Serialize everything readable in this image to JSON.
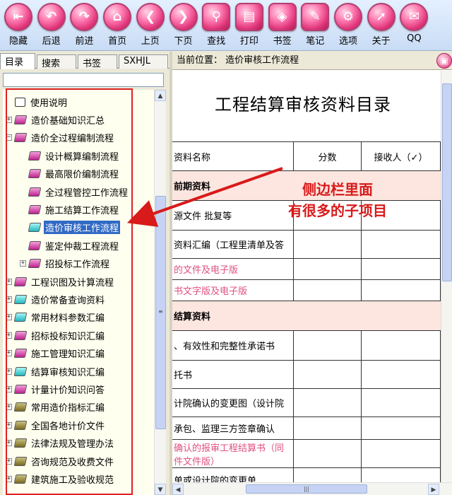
{
  "toolbar": {
    "buttons": [
      {
        "label": "隐藏",
        "icon": "hide-icon",
        "glyph": "⇤"
      },
      {
        "label": "后退",
        "icon": "back-icon",
        "glyph": "↶"
      },
      {
        "label": "前进",
        "icon": "forward-icon",
        "glyph": "↷"
      },
      {
        "label": "首页",
        "icon": "home-icon",
        "glyph": "⌂"
      },
      {
        "label": "上页",
        "icon": "prev-page-icon",
        "glyph": "❮"
      },
      {
        "label": "下页",
        "icon": "next-page-icon",
        "glyph": "❯"
      },
      {
        "label": "查找",
        "icon": "binoculars-icon",
        "glyph": "⚲"
      },
      {
        "label": "打印",
        "icon": "printer-icon",
        "glyph": "▤"
      },
      {
        "label": "书签",
        "icon": "bookmark-tag-icon",
        "glyph": "◈"
      },
      {
        "label": "笔记",
        "icon": "note-icon",
        "glyph": "✎"
      },
      {
        "label": "选项",
        "icon": "gear-icon",
        "glyph": "⚙"
      },
      {
        "label": "关于",
        "icon": "pointer-icon",
        "glyph": "➚"
      },
      {
        "label": "QQ",
        "icon": "qq-icon",
        "glyph": "✉"
      }
    ]
  },
  "left_panel": {
    "tabs": [
      "目录",
      "搜索",
      "书签",
      "SXHJL"
    ],
    "active_tab": "目录",
    "search_value": "",
    "tree": [
      {
        "label": "使用说明",
        "level": 0,
        "expander": "",
        "book": "open"
      },
      {
        "label": "造价基础知识汇总",
        "level": 0,
        "expander": "+",
        "book": "pink"
      },
      {
        "label": "造价全过程编制流程",
        "level": 0,
        "expander": "−",
        "book": "pink"
      },
      {
        "label": "设计概算编制流程",
        "level": 1,
        "expander": "",
        "book": "pink"
      },
      {
        "label": "最高限价编制流程",
        "level": 1,
        "expander": "",
        "book": "pink"
      },
      {
        "label": "全过程管控工作流程",
        "level": 1,
        "expander": "",
        "book": "pink"
      },
      {
        "label": "施工结算工作流程",
        "level": 1,
        "expander": "",
        "book": "pink"
      },
      {
        "label": "造价审核工作流程",
        "level": 1,
        "expander": "",
        "book": "cyan",
        "selected": true
      },
      {
        "label": "鉴定仲裁工程流程",
        "level": 1,
        "expander": "",
        "book": "pink"
      },
      {
        "label": "招投标工作流程",
        "level": 1,
        "expander": "+",
        "book": "pink"
      },
      {
        "label": "工程识图及计算流程",
        "level": 0,
        "expander": "+",
        "book": "pink"
      },
      {
        "label": "造价常备查询资料",
        "level": 0,
        "expander": "+",
        "book": "cyan"
      },
      {
        "label": "常用材料参数汇编",
        "level": 0,
        "expander": "+",
        "book": "cyan"
      },
      {
        "label": "招标投标知识汇编",
        "level": 0,
        "expander": "+",
        "book": "pink"
      },
      {
        "label": "施工管理知识汇编",
        "level": 0,
        "expander": "+",
        "book": "pink"
      },
      {
        "label": "结算审核知识汇编",
        "level": 0,
        "expander": "+",
        "book": "cyan"
      },
      {
        "label": "计量计价知识问答",
        "level": 0,
        "expander": "+",
        "book": "pink"
      },
      {
        "label": "常用造价指标汇编",
        "level": 0,
        "expander": "+",
        "book": "olive"
      },
      {
        "label": "全国各地计价文件",
        "level": 0,
        "expander": "+",
        "book": "olive"
      },
      {
        "label": "法律法规及管理办法",
        "level": 0,
        "expander": "+",
        "book": "olive"
      },
      {
        "label": "咨询规范及收费文件",
        "level": 0,
        "expander": "+",
        "book": "olive"
      },
      {
        "label": "建筑施工及验收规范",
        "level": 0,
        "expander": "+",
        "book": "olive"
      }
    ]
  },
  "right_panel": {
    "location": "当前位置：  造价审核工作流程",
    "doc_title": "工程结算审核资料目录",
    "header": [
      "资料名称",
      "分数",
      "接收人（✓）"
    ],
    "rows": [
      {
        "type": "section",
        "text": "前期资料"
      },
      {
        "type": "row",
        "text": "源文件   批复等"
      },
      {
        "type": "row",
        "text": "资料汇编（工程里清单及答"
      },
      {
        "type": "row",
        "text": "的文件及电子版",
        "pink": true
      },
      {
        "type": "row",
        "text": "书文字版及电子版",
        "pink": true
      },
      {
        "type": "section",
        "text": "结算资料"
      },
      {
        "type": "row",
        "text": "、有效性和完整性承诺书"
      },
      {
        "type": "row",
        "text": "托书"
      },
      {
        "type": "row",
        "text": "计院确认的变更图（设计院"
      },
      {
        "type": "row",
        "text": "承包、监理三方签章确认"
      },
      {
        "type": "row",
        "text": "确认的报审工程结算书（同 件文件版）",
        "pink": true
      },
      {
        "type": "row",
        "text": "单或设计院的变更单"
      }
    ]
  },
  "annotation": {
    "line1": "侧边栏里面",
    "line2": "有很多的子项目",
    "color": "#d81a1a"
  }
}
